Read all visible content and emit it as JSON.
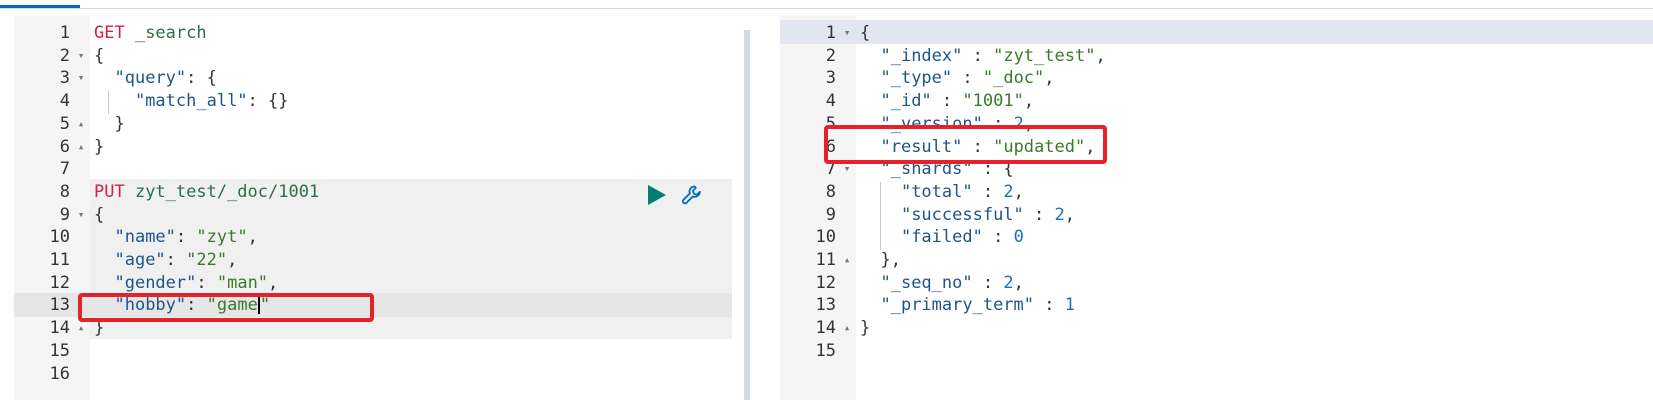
{
  "left_editor": {
    "lines": [
      {
        "n": "1",
        "fold": "",
        "parts": [
          {
            "t": "GET",
            "c": "method"
          },
          {
            "t": " _search",
            "c": "url"
          }
        ]
      },
      {
        "n": "2",
        "fold": "▾",
        "parts": [
          {
            "t": "{",
            "c": "punc"
          }
        ]
      },
      {
        "n": "3",
        "fold": "▾",
        "parts": [
          {
            "t": "  ",
            "c": "punc"
          },
          {
            "t": "\"query\"",
            "c": "key"
          },
          {
            "t": ": {",
            "c": "punc"
          }
        ]
      },
      {
        "n": "4",
        "fold": "",
        "parts": [
          {
            "t": "    ",
            "c": "punc"
          },
          {
            "t": "\"match_all\"",
            "c": "key"
          },
          {
            "t": ": {}",
            "c": "punc"
          }
        ]
      },
      {
        "n": "5",
        "fold": "▴",
        "parts": [
          {
            "t": "  }",
            "c": "punc"
          }
        ]
      },
      {
        "n": "6",
        "fold": "▴",
        "parts": [
          {
            "t": "}",
            "c": "punc"
          }
        ]
      },
      {
        "n": "7",
        "fold": "",
        "parts": []
      },
      {
        "n": "8",
        "fold": "",
        "parts": [
          {
            "t": "PUT",
            "c": "method"
          },
          {
            "t": " zyt_test/_doc/1001",
            "c": "url"
          }
        ]
      },
      {
        "n": "9",
        "fold": "▾",
        "parts": [
          {
            "t": "{",
            "c": "punc"
          }
        ]
      },
      {
        "n": "10",
        "fold": "",
        "parts": [
          {
            "t": "  ",
            "c": "punc"
          },
          {
            "t": "\"name\"",
            "c": "key"
          },
          {
            "t": ": ",
            "c": "punc"
          },
          {
            "t": "\"zyt\"",
            "c": "str"
          },
          {
            "t": ",",
            "c": "punc"
          }
        ]
      },
      {
        "n": "11",
        "fold": "",
        "parts": [
          {
            "t": "  ",
            "c": "punc"
          },
          {
            "t": "\"age\"",
            "c": "key"
          },
          {
            "t": ": ",
            "c": "punc"
          },
          {
            "t": "\"22\"",
            "c": "str"
          },
          {
            "t": ",",
            "c": "punc"
          }
        ]
      },
      {
        "n": "12",
        "fold": "",
        "parts": [
          {
            "t": "  ",
            "c": "punc"
          },
          {
            "t": "\"gender\"",
            "c": "key"
          },
          {
            "t": ": ",
            "c": "punc"
          },
          {
            "t": "\"man\"",
            "c": "str"
          },
          {
            "t": ",",
            "c": "punc"
          }
        ]
      },
      {
        "n": "13",
        "fold": "",
        "parts": [
          {
            "t": "  ",
            "c": "punc"
          },
          {
            "t": "\"hobby\"",
            "c": "key"
          },
          {
            "t": ": ",
            "c": "punc"
          },
          {
            "t": "\"game",
            "c": "str"
          },
          {
            "t": "|CURSOR|",
            "c": "cursor"
          },
          {
            "t": "\"",
            "c": "str"
          }
        ]
      },
      {
        "n": "14",
        "fold": "▴",
        "parts": [
          {
            "t": "}",
            "c": "punc"
          }
        ]
      },
      {
        "n": "15",
        "fold": "",
        "parts": []
      },
      {
        "n": "16",
        "fold": "",
        "parts": []
      }
    ]
  },
  "right_editor": {
    "lines": [
      {
        "n": "1",
        "fold": "▾",
        "parts": [
          {
            "t": "{",
            "c": "punc"
          }
        ]
      },
      {
        "n": "2",
        "fold": "",
        "parts": [
          {
            "t": "  ",
            "c": "punc"
          },
          {
            "t": "\"_index\"",
            "c": "key"
          },
          {
            "t": " : ",
            "c": "punc"
          },
          {
            "t": "\"zyt_test\"",
            "c": "str"
          },
          {
            "t": ",",
            "c": "punc"
          }
        ]
      },
      {
        "n": "3",
        "fold": "",
        "parts": [
          {
            "t": "  ",
            "c": "punc"
          },
          {
            "t": "\"_type\"",
            "c": "key"
          },
          {
            "t": " : ",
            "c": "punc"
          },
          {
            "t": "\"_doc\"",
            "c": "str"
          },
          {
            "t": ",",
            "c": "punc"
          }
        ]
      },
      {
        "n": "4",
        "fold": "",
        "parts": [
          {
            "t": "  ",
            "c": "punc"
          },
          {
            "t": "\"_id\"",
            "c": "key"
          },
          {
            "t": " : ",
            "c": "punc"
          },
          {
            "t": "\"1001\"",
            "c": "str"
          },
          {
            "t": ",",
            "c": "punc"
          }
        ]
      },
      {
        "n": "5",
        "fold": "",
        "parts": [
          {
            "t": "  ",
            "c": "punc"
          },
          {
            "t": "\"_version\"",
            "c": "key"
          },
          {
            "t": " : ",
            "c": "punc"
          },
          {
            "t": "2",
            "c": "num"
          },
          {
            "t": ",",
            "c": "punc"
          }
        ]
      },
      {
        "n": "6",
        "fold": "",
        "parts": [
          {
            "t": "  ",
            "c": "punc"
          },
          {
            "t": "\"result\"",
            "c": "key"
          },
          {
            "t": " : ",
            "c": "punc"
          },
          {
            "t": "\"updated\"",
            "c": "str"
          },
          {
            "t": ",",
            "c": "punc"
          }
        ]
      },
      {
        "n": "7",
        "fold": "▾",
        "parts": [
          {
            "t": "  ",
            "c": "punc"
          },
          {
            "t": "\"_shards\"",
            "c": "key"
          },
          {
            "t": " : {",
            "c": "punc"
          }
        ]
      },
      {
        "n": "8",
        "fold": "",
        "parts": [
          {
            "t": "    ",
            "c": "punc"
          },
          {
            "t": "\"total\"",
            "c": "key"
          },
          {
            "t": " : ",
            "c": "punc"
          },
          {
            "t": "2",
            "c": "num"
          },
          {
            "t": ",",
            "c": "punc"
          }
        ]
      },
      {
        "n": "9",
        "fold": "",
        "parts": [
          {
            "t": "    ",
            "c": "punc"
          },
          {
            "t": "\"successful\"",
            "c": "key"
          },
          {
            "t": " : ",
            "c": "punc"
          },
          {
            "t": "2",
            "c": "num"
          },
          {
            "t": ",",
            "c": "punc"
          }
        ]
      },
      {
        "n": "10",
        "fold": "",
        "parts": [
          {
            "t": "    ",
            "c": "punc"
          },
          {
            "t": "\"failed\"",
            "c": "key"
          },
          {
            "t": " : ",
            "c": "punc"
          },
          {
            "t": "0",
            "c": "num"
          }
        ]
      },
      {
        "n": "11",
        "fold": "▴",
        "parts": [
          {
            "t": "  },",
            "c": "punc"
          }
        ]
      },
      {
        "n": "12",
        "fold": "",
        "parts": [
          {
            "t": "  ",
            "c": "punc"
          },
          {
            "t": "\"_seq_no\"",
            "c": "key"
          },
          {
            "t": " : ",
            "c": "punc"
          },
          {
            "t": "2",
            "c": "num"
          },
          {
            "t": ",",
            "c": "punc"
          }
        ]
      },
      {
        "n": "13",
        "fold": "",
        "parts": [
          {
            "t": "  ",
            "c": "punc"
          },
          {
            "t": "\"_primary_term\"",
            "c": "key"
          },
          {
            "t": " : ",
            "c": "punc"
          },
          {
            "t": "1",
            "c": "num"
          }
        ]
      },
      {
        "n": "14",
        "fold": "▴",
        "parts": [
          {
            "t": "}",
            "c": "punc"
          }
        ]
      },
      {
        "n": "15",
        "fold": "",
        "parts": []
      }
    ]
  },
  "actions": {
    "play_icon": "play-icon",
    "settings_icon": "wrench-icon"
  },
  "colors": {
    "annotation_box": "#e5212a",
    "method": "#c7254e",
    "key": "#20558a",
    "string": "#3a7a2a",
    "number": "#1f6fb5"
  }
}
